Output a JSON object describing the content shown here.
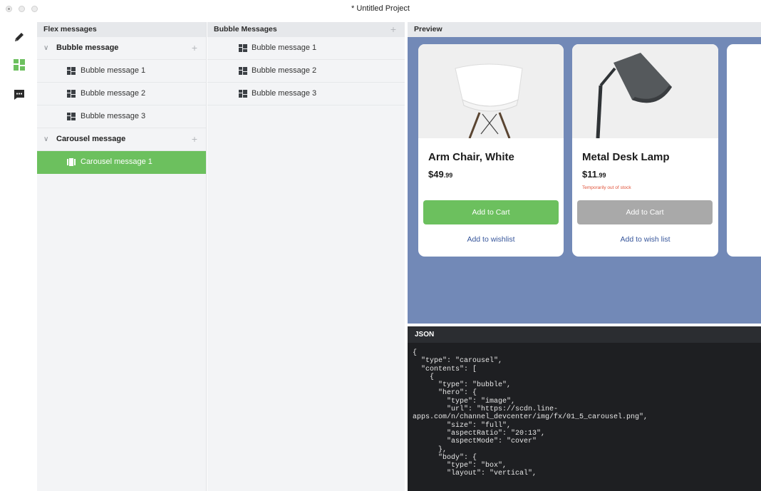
{
  "window": {
    "title": "* Untitled Project"
  },
  "rail": {
    "icons": [
      "pencil-icon",
      "grid-icon",
      "chat-icon"
    ],
    "active_color": "#6cc05e"
  },
  "flex_panel": {
    "header": "Flex messages",
    "groups": [
      {
        "label": "Bubble message",
        "items": [
          "Bubble message 1",
          "Bubble message 2",
          "Bubble message 3"
        ]
      },
      {
        "label": "Carousel message",
        "items": [
          "Carousel message 1"
        ]
      }
    ],
    "plus": "+",
    "chevron": "∨"
  },
  "bubble_panel": {
    "header": "Bubble Messages",
    "plus": "+",
    "items": [
      "Bubble message 1",
      "Bubble message 2",
      "Bubble message 3"
    ]
  },
  "preview": {
    "header": "Preview",
    "background": "#7289b7",
    "cards": [
      {
        "title": "Arm Chair, White",
        "price_main": "$49",
        "price_cents": ".99",
        "stock": "",
        "cart_label": "Add to Cart",
        "cart_color": "#6cc05e",
        "wish_label": "Add to wishlist"
      },
      {
        "title": "Metal Desk Lamp",
        "price_main": "$11",
        "price_cents": ".99",
        "stock": "Temporarily out of stock",
        "cart_label": "Add to Cart",
        "cart_color": "#a9a9a9",
        "wish_label": "Add to wish list"
      }
    ]
  },
  "json_panel": {
    "header": "JSON",
    "code": "{\n  \"type\": \"carousel\",\n  \"contents\": [\n    {\n      \"type\": \"bubble\",\n      \"hero\": {\n        \"type\": \"image\",\n        \"url\": \"https://scdn.line-\napps.com/n/channel_devcenter/img/fx/01_5_carousel.png\",\n        \"size\": \"full\",\n        \"aspectRatio\": \"20:13\",\n        \"aspectMode\": \"cover\"\n      },\n      \"body\": {\n        \"type\": \"box\",\n        \"layout\": \"vertical\","
  }
}
